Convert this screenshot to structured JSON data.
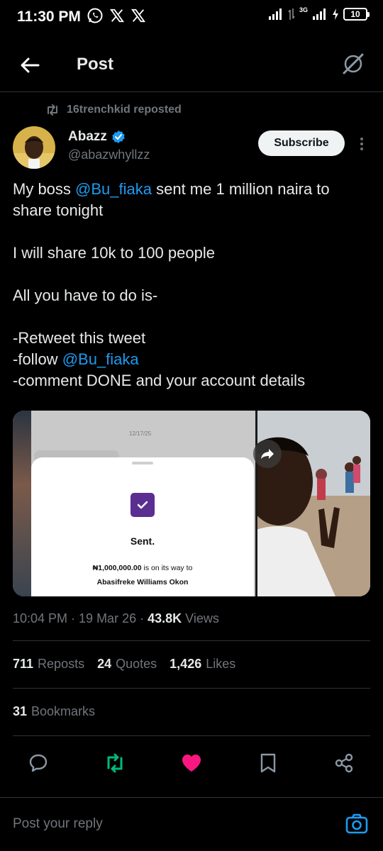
{
  "status_bar": {
    "time": "11:30 PM",
    "network_label": "3G",
    "battery": "10",
    "icons": [
      "whatsapp-icon",
      "x-logo-icon",
      "x-logo-icon",
      "signal-icon",
      "signal-icon",
      "battery-icon"
    ]
  },
  "header": {
    "title": "Post",
    "back_icon": "arrow-left-icon",
    "grok_icon": "grok-icon"
  },
  "post": {
    "repost_by": "16trenchkid reposted",
    "author": {
      "name": "Abazz",
      "handle": "@abazwhyllzz",
      "verified": true
    },
    "subscribe_label": "Subscribe",
    "text": {
      "line1_pre": "My boss ",
      "line1_mention": "@Bu_fiaka",
      "line1_post": " sent me 1 million naira to share tonight",
      "line2": "I will share 10k to 100 people",
      "line3": "All you have to do is-",
      "line4": "-Retweet this tweet",
      "line5_pre": "-follow ",
      "line5_mention": "@Bu_fiaka",
      "line6": "-comment DONE and your account details"
    },
    "media": {
      "receipt_date": "12/17/25",
      "receipt_status": "Sent.",
      "receipt_amount": "₦1,000,000.00",
      "receipt_amount_suffix": " is on its way to",
      "receipt_recipient": "Abasifreke Williams Okon"
    },
    "timestamp": "10:04 PM · 19 Mar 26 · ",
    "views_count": "43.8K",
    "views_label": " Views",
    "stats": {
      "reposts_count": "711",
      "reposts_label": "Reposts",
      "quotes_count": "24",
      "quotes_label": "Quotes",
      "likes_count": "1,426",
      "likes_label": "Likes",
      "bookmarks_count": "31",
      "bookmarks_label": "Bookmarks"
    }
  },
  "actions": [
    "reply-icon",
    "repost-icon",
    "like-icon",
    "bookmark-icon",
    "share-icon"
  ],
  "colors": {
    "accent": "#1d9bf0",
    "repost_green": "#00ba7c",
    "like_pink": "#f91880",
    "muted": "#71767b"
  },
  "reply": {
    "placeholder": "Post your reply"
  }
}
